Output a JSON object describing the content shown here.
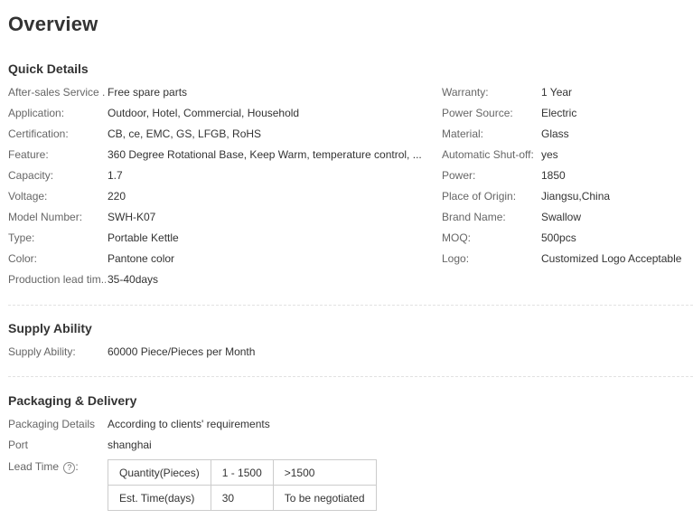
{
  "page_title": "Overview",
  "quick_details": {
    "title": "Quick Details",
    "left": [
      {
        "label": "After-sales Service ...",
        "value": "Free spare parts"
      },
      {
        "label": "Application:",
        "value": "Outdoor, Hotel, Commercial, Household"
      },
      {
        "label": "Certification:",
        "value": "CB, ce, EMC, GS, LFGB, RoHS"
      },
      {
        "label": "Feature:",
        "value": "360 Degree Rotational Base, Keep Warm, temperature control, ..."
      },
      {
        "label": "Capacity:",
        "value": "1.7"
      },
      {
        "label": "Voltage:",
        "value": "220"
      },
      {
        "label": "Model Number:",
        "value": "SWH-K07"
      },
      {
        "label": "Type:",
        "value": "Portable Kettle"
      },
      {
        "label": "Color:",
        "value": "Pantone color"
      },
      {
        "label": "Production lead tim...",
        "value": "35-40days"
      }
    ],
    "right": [
      {
        "label": "Warranty:",
        "value": "1 Year"
      },
      {
        "label": "Power Source:",
        "value": "Electric"
      },
      {
        "label": "Material:",
        "value": "Glass"
      },
      {
        "label": "Automatic Shut-off:",
        "value": "yes"
      },
      {
        "label": "Power:",
        "value": "1850"
      },
      {
        "label": "Place of Origin:",
        "value": "Jiangsu,China"
      },
      {
        "label": "Brand Name:",
        "value": "Swallow"
      },
      {
        "label": "MOQ:",
        "value": "500pcs"
      },
      {
        "label": "Logo:",
        "value": "Customized Logo Acceptable"
      }
    ]
  },
  "supply_ability": {
    "title": "Supply Ability",
    "label": "Supply Ability:",
    "value": "60000 Piece/Pieces per Month"
  },
  "packaging": {
    "title": "Packaging & Delivery",
    "details_label": "Packaging Details",
    "details_value": "According to clients' requirements",
    "port_label": "Port",
    "port_value": "shanghai",
    "lead_time_label": "Lead Time",
    "help_icon": "question-circle-icon",
    "help_glyph": "?",
    "lead_time_table": {
      "rows": [
        [
          "Quantity(Pieces)",
          "1 - 1500",
          ">1500"
        ],
        [
          "Est. Time(days)",
          "30",
          "To be negotiated"
        ]
      ]
    }
  }
}
